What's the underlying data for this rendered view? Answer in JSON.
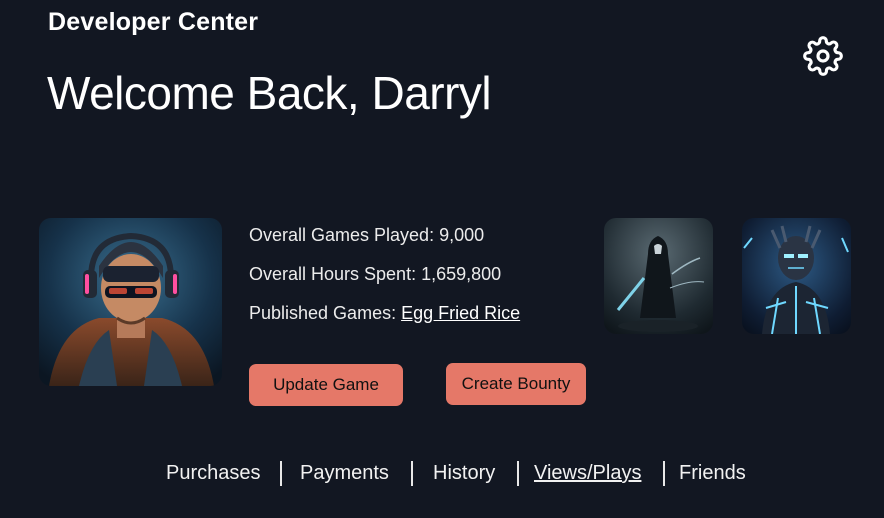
{
  "header": {
    "app_title": "Developer Center",
    "welcome": "Welcome Back, Darryl",
    "settings_icon": "gear-icon"
  },
  "profile": {
    "avatar_description": "developer-avatar",
    "games_played_label": "Overall Games Played: 9,000",
    "hours_spent_label": "Overall Hours Spent: 1,659,800",
    "published_games_label": "Published Games: ",
    "published_game_link": "Egg Fried Rice"
  },
  "actions": {
    "update_game": "Update Game",
    "create_bounty": "Create Bounty",
    "button_color": "#e57868"
  },
  "nav": {
    "items": [
      "Purchases",
      "Payments",
      "History",
      "Views/Plays",
      "Friends"
    ],
    "active": "Views/Plays"
  },
  "colors": {
    "background": "#121722",
    "text": "#ffffff",
    "accent": "#e57868"
  }
}
